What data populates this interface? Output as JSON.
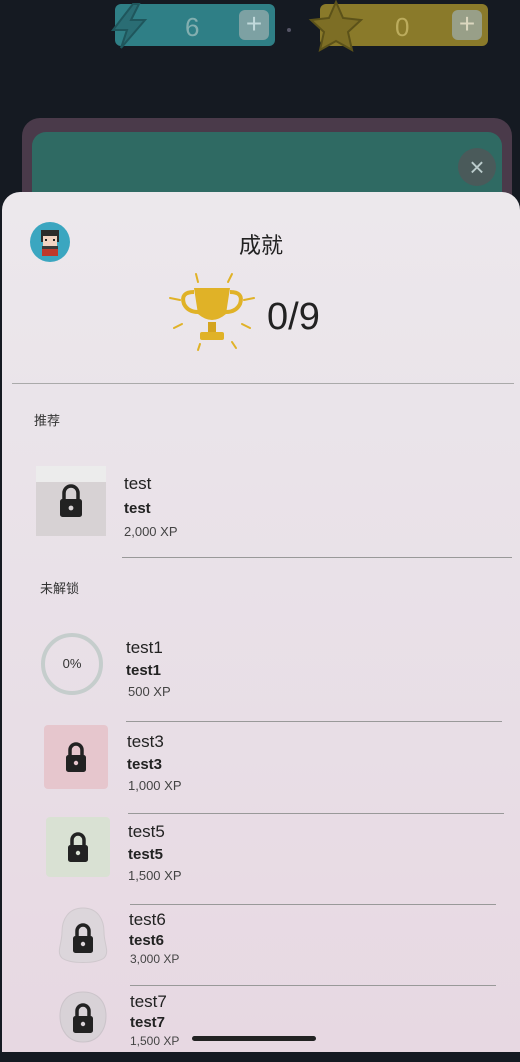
{
  "hud": {
    "energy_count": "6",
    "star_count": "0",
    "plus_label": "+",
    "close_label": "×"
  },
  "sheet": {
    "title": "成就",
    "score": "0/9"
  },
  "sections": {
    "recommended": "推荐",
    "locked": "未解锁"
  },
  "recommended": [
    {
      "name": "test",
      "desc": "test",
      "xp": "2,000 XP",
      "icon": "lock-icon"
    }
  ],
  "locked": [
    {
      "name": "test1",
      "desc": "test1",
      "xp": "500 XP",
      "progress": "0%",
      "progress_value": 0
    },
    {
      "name": "test3",
      "desc": "test3",
      "xp": "1,000 XP",
      "icon": "lock-icon",
      "bg": "#e6c6cd"
    },
    {
      "name": "test5",
      "desc": "test5",
      "xp": "1,500 XP",
      "icon": "lock-icon",
      "bg": "#d9e1d3"
    },
    {
      "name": "test6",
      "desc": "test6",
      "xp": "3,000 XP",
      "icon": "lock-icon"
    },
    {
      "name": "test7",
      "desc": "test7",
      "xp": "1,500 XP",
      "icon": "lock-icon"
    }
  ],
  "colors": {
    "trophy": "#e0b227",
    "energy_pill": "#2f7f86",
    "star_pill": "#8a7a2a",
    "avatar_bg": "#3ba6c0"
  }
}
